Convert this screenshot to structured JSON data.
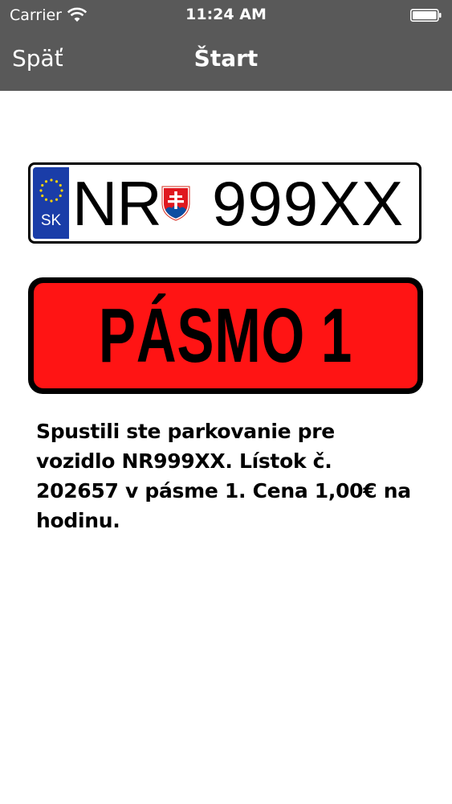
{
  "status_bar": {
    "carrier": "Carrier",
    "time": "11:24 AM"
  },
  "nav": {
    "back_label": "Späť",
    "title": "Štart"
  },
  "plate": {
    "country_code": "SK",
    "district": "NR",
    "number": "999XX"
  },
  "zone": {
    "label": "PÁSMO 1"
  },
  "message": "Spustili ste parkovanie pre vozidlo NR999XX. Lístok č. 202657 v pásme 1. Cena 1,00€ na hodinu.",
  "colors": {
    "header_bg": "#595959",
    "eu_blue": "#1a3da8",
    "zone_red": "#ff1414"
  },
  "icons": {
    "wifi": "wifi-icon",
    "battery": "battery-icon",
    "eu_stars": "eu-stars-icon",
    "coat_of_arms": "slovak-coat-of-arms-icon"
  }
}
